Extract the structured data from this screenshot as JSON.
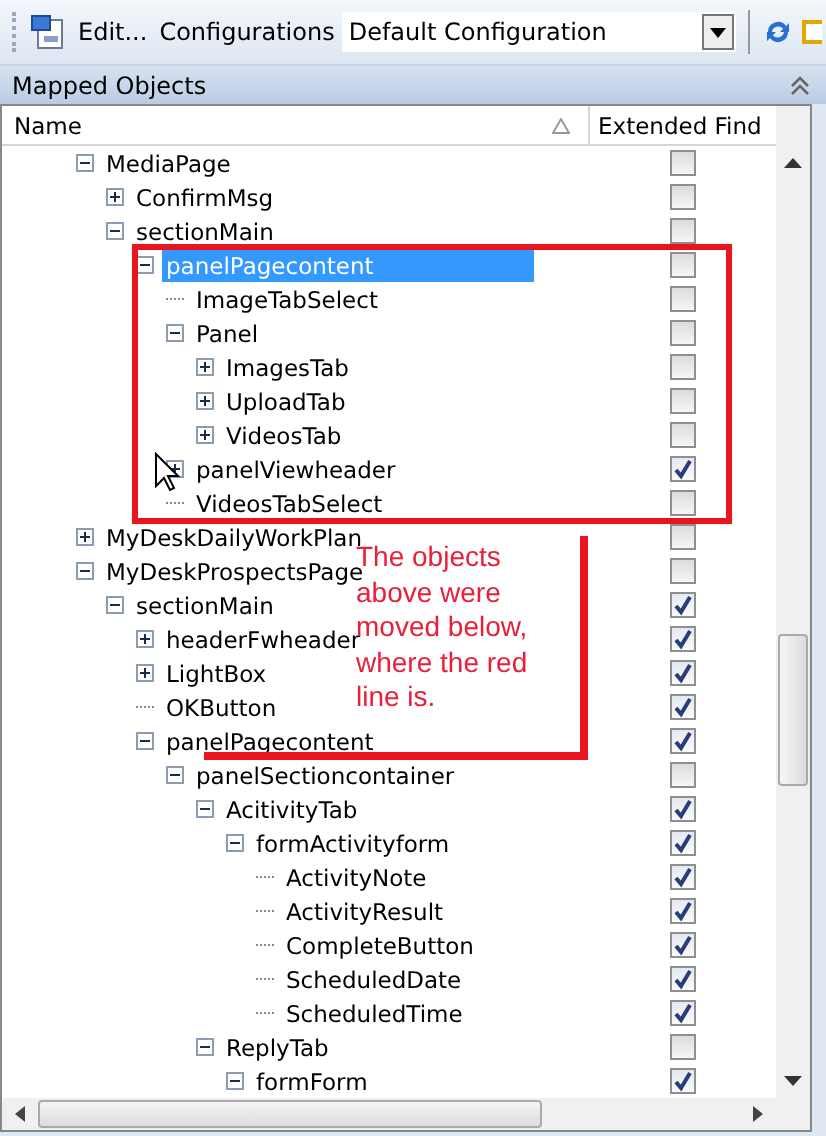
{
  "toolbar": {
    "edit_button": "Edit...",
    "configurations_label": "Configurations",
    "configuration_combo": "Default Configuration"
  },
  "panel": {
    "title": "Mapped Objects"
  },
  "table": {
    "columns": [
      {
        "label": "Name"
      },
      {
        "label": "Extended Find"
      }
    ],
    "rows": [
      {
        "name": "MediaPage",
        "kind": "node",
        "expanded": true,
        "checked": false,
        "selected": false,
        "children": [
          {
            "name": "ConfirmMsg",
            "kind": "node",
            "expanded": false,
            "checked": false,
            "selected": false
          },
          {
            "name": "sectionMain",
            "kind": "node",
            "expanded": true,
            "checked": false,
            "selected": false,
            "children": [
              {
                "name": "panelPagecontent",
                "kind": "node",
                "expanded": true,
                "checked": false,
                "selected": true,
                "children": [
                  {
                    "name": "ImageTabSelect",
                    "kind": "leaf",
                    "checked": false,
                    "selected": false
                  },
                  {
                    "name": "Panel",
                    "kind": "node",
                    "expanded": true,
                    "checked": false,
                    "selected": false,
                    "children": [
                      {
                        "name": "ImagesTab",
                        "kind": "node",
                        "expanded": false,
                        "checked": false,
                        "selected": false
                      },
                      {
                        "name": "UploadTab",
                        "kind": "node",
                        "expanded": false,
                        "checked": false,
                        "selected": false
                      },
                      {
                        "name": "VideosTab",
                        "kind": "node",
                        "expanded": false,
                        "checked": false,
                        "selected": false
                      }
                    ]
                  },
                  {
                    "name": "panelViewheader",
                    "kind": "node",
                    "expanded": false,
                    "checked": true,
                    "selected": false
                  },
                  {
                    "name": "VideosTabSelect",
                    "kind": "leaf",
                    "checked": false,
                    "selected": false
                  }
                ]
              }
            ]
          }
        ]
      },
      {
        "name": "MyDeskDailyWorkPlan",
        "kind": "node",
        "expanded": false,
        "checked": false,
        "selected": false
      },
      {
        "name": "MyDeskProspectsPage",
        "kind": "node",
        "expanded": true,
        "checked": false,
        "selected": false,
        "children": [
          {
            "name": "sectionMain",
            "kind": "node",
            "expanded": true,
            "checked": true,
            "selected": false,
            "children": [
              {
                "name": "headerFwheader",
                "kind": "node",
                "expanded": false,
                "checked": true,
                "selected": false
              },
              {
                "name": "LightBox",
                "kind": "node",
                "expanded": false,
                "checked": true,
                "selected": false
              },
              {
                "name": "OKButton",
                "kind": "leaf",
                "checked": true,
                "selected": false
              },
              {
                "name": "panelPagecontent",
                "kind": "node",
                "expanded": true,
                "checked": true,
                "selected": false,
                "children": [
                  {
                    "name": "panelSectioncontainer",
                    "kind": "node",
                    "expanded": true,
                    "checked": false,
                    "selected": false,
                    "children": [
                      {
                        "name": "AcitivityTab",
                        "kind": "node",
                        "expanded": true,
                        "checked": true,
                        "selected": false,
                        "children": [
                          {
                            "name": "formActivityform",
                            "kind": "node",
                            "expanded": true,
                            "checked": true,
                            "selected": false,
                            "children": [
                              {
                                "name": "ActivityNote",
                                "kind": "leaf",
                                "checked": true,
                                "selected": false
                              },
                              {
                                "name": "ActivityResult",
                                "kind": "leaf",
                                "checked": true,
                                "selected": false
                              },
                              {
                                "name": "CompleteButton",
                                "kind": "leaf",
                                "checked": true,
                                "selected": false
                              },
                              {
                                "name": "ScheduledDate",
                                "kind": "leaf",
                                "checked": true,
                                "selected": false
                              },
                              {
                                "name": "ScheduledTime",
                                "kind": "leaf",
                                "checked": true,
                                "selected": false
                              }
                            ]
                          }
                        ]
                      },
                      {
                        "name": "ReplyTab",
                        "kind": "node",
                        "expanded": true,
                        "checked": false,
                        "selected": false,
                        "children": [
                          {
                            "name": "formForm",
                            "kind": "node",
                            "expanded": true,
                            "checked": true,
                            "selected": false
                          }
                        ]
                      }
                    ]
                  }
                ]
              }
            ]
          }
        ]
      }
    ]
  },
  "annotation": {
    "note": "The objects above were moved below, where the red line is."
  }
}
